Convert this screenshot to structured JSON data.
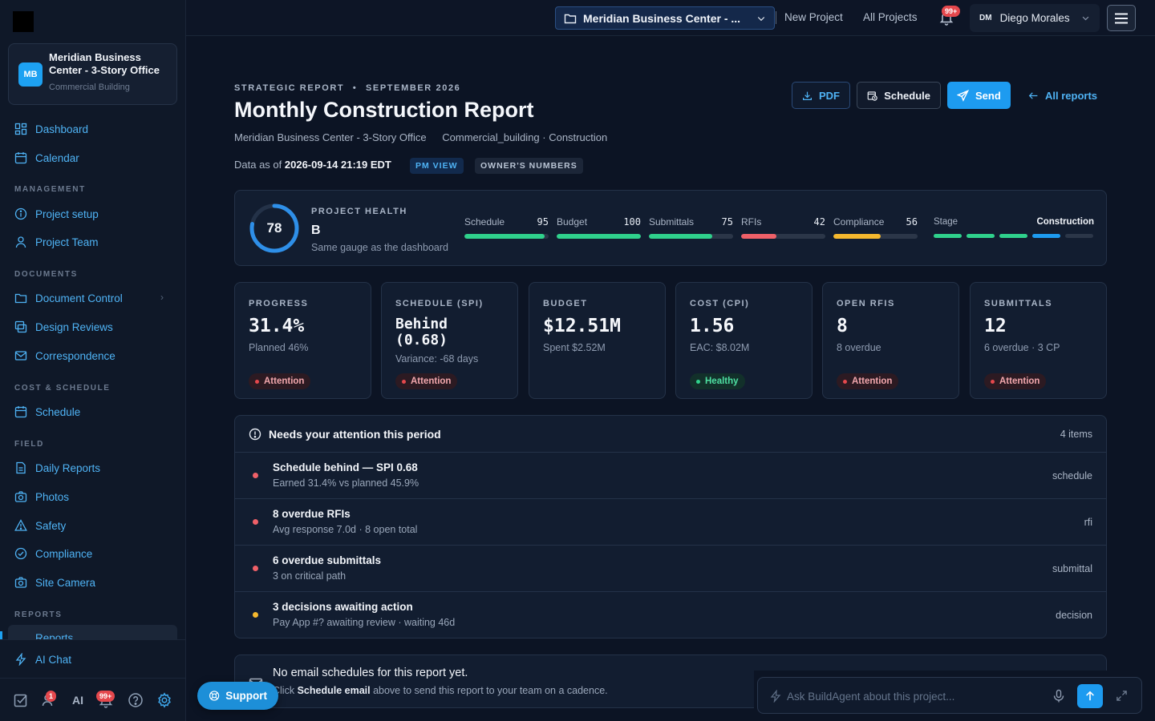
{
  "project": {
    "initials": "MB",
    "name": "Meridian Business Center - 3-Story Office",
    "type": "Commercial Building"
  },
  "sidebar": {
    "dashboard": "Dashboard",
    "calendar": "Calendar",
    "management_label": "MANAGEMENT",
    "project_setup": "Project setup",
    "project_team": "Project Team",
    "documents_label": "DOCUMENTS",
    "document_control": "Document Control",
    "design_reviews": "Design Reviews",
    "correspondence": "Correspondence",
    "cost_schedule_label": "COST & SCHEDULE",
    "schedule": "Schedule",
    "field_label": "FIELD",
    "daily_reports": "Daily Reports",
    "photos": "Photos",
    "safety": "Safety",
    "compliance": "Compliance",
    "site_camera": "Site Camera",
    "reports_label": "REPORTS",
    "reports": "Reports",
    "ai_chat": "AI Chat",
    "bottom": {
      "team_badge": "1",
      "ai_label": "AI",
      "notif_badge": "99+"
    }
  },
  "topbar": {
    "project_select": "Meridian Business Center - ...",
    "new_project": "New Project",
    "all_projects": "All Projects",
    "bell_badge": "99+",
    "user_initials": "DM",
    "user_name": "Diego Morales"
  },
  "header": {
    "eyebrow_type": "STRATEGIC REPORT",
    "eyebrow_date": "SEPTEMBER 2026",
    "title": "Monthly Construction Report",
    "project_name": "Meridian Business Center - 3-Story Office",
    "project_meta": "Commercial_building · Construction",
    "asof_prefix": "Data as of",
    "asof_value": "2026-09-14 21:19 EDT",
    "chip_pm": "PM VIEW",
    "chip_owner": "OWNER'S NUMBERS",
    "btn_pdf": "PDF",
    "btn_schedule": "Schedule",
    "btn_send": "Send",
    "btn_all_reports": "All reports"
  },
  "health": {
    "score": "78",
    "score_fraction": 0.78,
    "label": "PROJECT HEALTH",
    "grade": "B",
    "note": "Same gauge as the dashboard",
    "metrics": [
      {
        "name": "Schedule",
        "value": "95",
        "pct": 95,
        "color": "#2fd18c"
      },
      {
        "name": "Budget",
        "value": "100",
        "pct": 100,
        "color": "#2fd18c"
      },
      {
        "name": "Submittals",
        "value": "75",
        "pct": 75,
        "color": "#2fd18c"
      },
      {
        "name": "RFIs",
        "value": "42",
        "pct": 42,
        "color": "#ef6068"
      },
      {
        "name": "Compliance",
        "value": "56",
        "pct": 56,
        "color": "#f5b82e"
      }
    ],
    "stage_label": "Stage",
    "stage_value": "Construction",
    "stage_segments": [
      "#2fd18c",
      "#2fd18c",
      "#2fd18c",
      "#1d9bf0",
      "#2b3648"
    ]
  },
  "kpis": [
    {
      "label": "PROGRESS",
      "value": "31.4%",
      "sub": "Planned 46%",
      "badge": "Attention",
      "status": "attention"
    },
    {
      "label": "SCHEDULE (SPI)",
      "value": "Behind (0.68)",
      "sub": "Variance: -68 days",
      "badge": "Attention",
      "status": "attention"
    },
    {
      "label": "BUDGET",
      "value": "$12.51M",
      "sub": "Spent $2.52M",
      "badge": "",
      "status": "none"
    },
    {
      "label": "COST (CPI)",
      "value": "1.56",
      "sub": "EAC: $8.02M",
      "badge": "Healthy",
      "status": "ok"
    },
    {
      "label": "OPEN RFIS",
      "value": "8",
      "sub": "8 overdue",
      "badge": "Attention",
      "status": "attention"
    },
    {
      "label": "SUBMITTALS",
      "value": "12",
      "sub": "6 overdue · 3 CP",
      "badge": "Attention",
      "status": "attention"
    }
  ],
  "attention": {
    "title": "Needs your attention this period",
    "count": "4 items",
    "rows": [
      {
        "title": "Schedule behind — SPI 0.68",
        "sub": "Earned 31.4% vs planned 45.9%",
        "tag": "schedule",
        "color": "#ef6068"
      },
      {
        "title": "8 overdue RFIs",
        "sub": "Avg response 7.0d · 8 open total",
        "tag": "rfi",
        "color": "#ef6068"
      },
      {
        "title": "6 overdue submittals",
        "sub": "3 on critical path",
        "tag": "submittal",
        "color": "#ef6068"
      },
      {
        "title": "3 decisions awaiting action",
        "sub": "Pay App #? awaiting review · waiting 46d",
        "tag": "decision",
        "color": "#f5b82e"
      }
    ]
  },
  "email": {
    "title": "No email schedules for this report yet.",
    "sub_prefix": "Click",
    "sub_bold": "Schedule email",
    "sub_suffix": "above to send this report to your team on a cadence."
  },
  "support": "Support",
  "ask": {
    "placeholder": "Ask BuildAgent about this project..."
  }
}
